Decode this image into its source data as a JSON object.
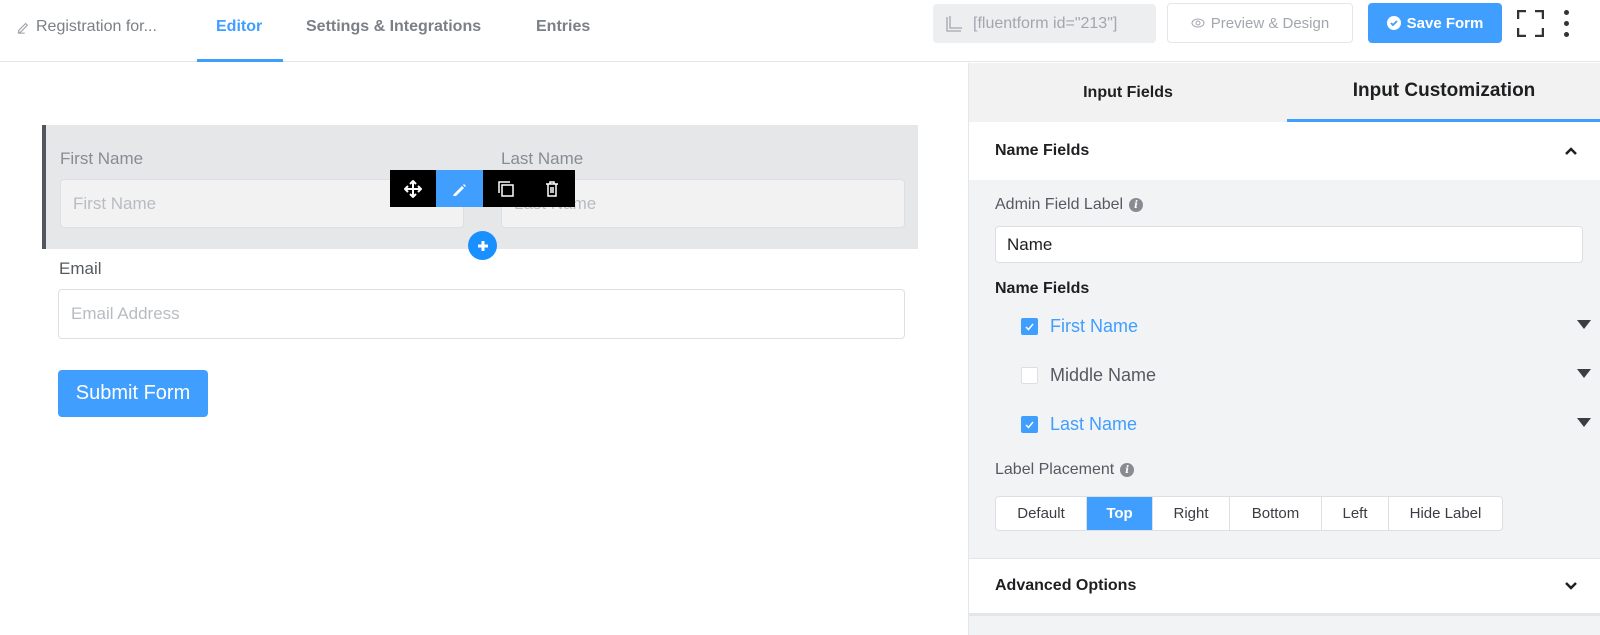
{
  "header": {
    "form_name": "Registration for...",
    "tabs": [
      {
        "label": "Editor",
        "active": true
      },
      {
        "label": "Settings & Integrations",
        "active": false
      },
      {
        "label": "Entries",
        "active": false
      }
    ],
    "shortcode": "[fluentform id=\"213\"]",
    "preview_label": "Preview & Design",
    "save_label": "Save Form"
  },
  "canvas": {
    "first_name": {
      "label": "First Name",
      "placeholder": "First Name"
    },
    "last_name": {
      "label": "Last Name",
      "placeholder": "Last Name"
    },
    "email": {
      "label": "Email",
      "placeholder": "Email Address"
    },
    "submit_label": "Submit Form"
  },
  "panel": {
    "tabs": [
      {
        "label": "Input Fields",
        "active": false
      },
      {
        "label": "Input Customization",
        "active": true
      }
    ],
    "section_title": "Name Fields",
    "admin_label": "Admin Field Label",
    "admin_value": "Name",
    "name_fields_label": "Name Fields",
    "name_fields": [
      {
        "label": "First Name",
        "checked": true
      },
      {
        "label": "Middle Name",
        "checked": false
      },
      {
        "label": "Last Name",
        "checked": true
      }
    ],
    "label_placement": {
      "label": "Label Placement",
      "options": [
        "Default",
        "Top",
        "Right",
        "Bottom",
        "Left",
        "Hide Label"
      ],
      "selected": "Top"
    },
    "advanced_title": "Advanced Options"
  },
  "colors": {
    "accent": "#409eff",
    "toolbar": "#000000"
  }
}
